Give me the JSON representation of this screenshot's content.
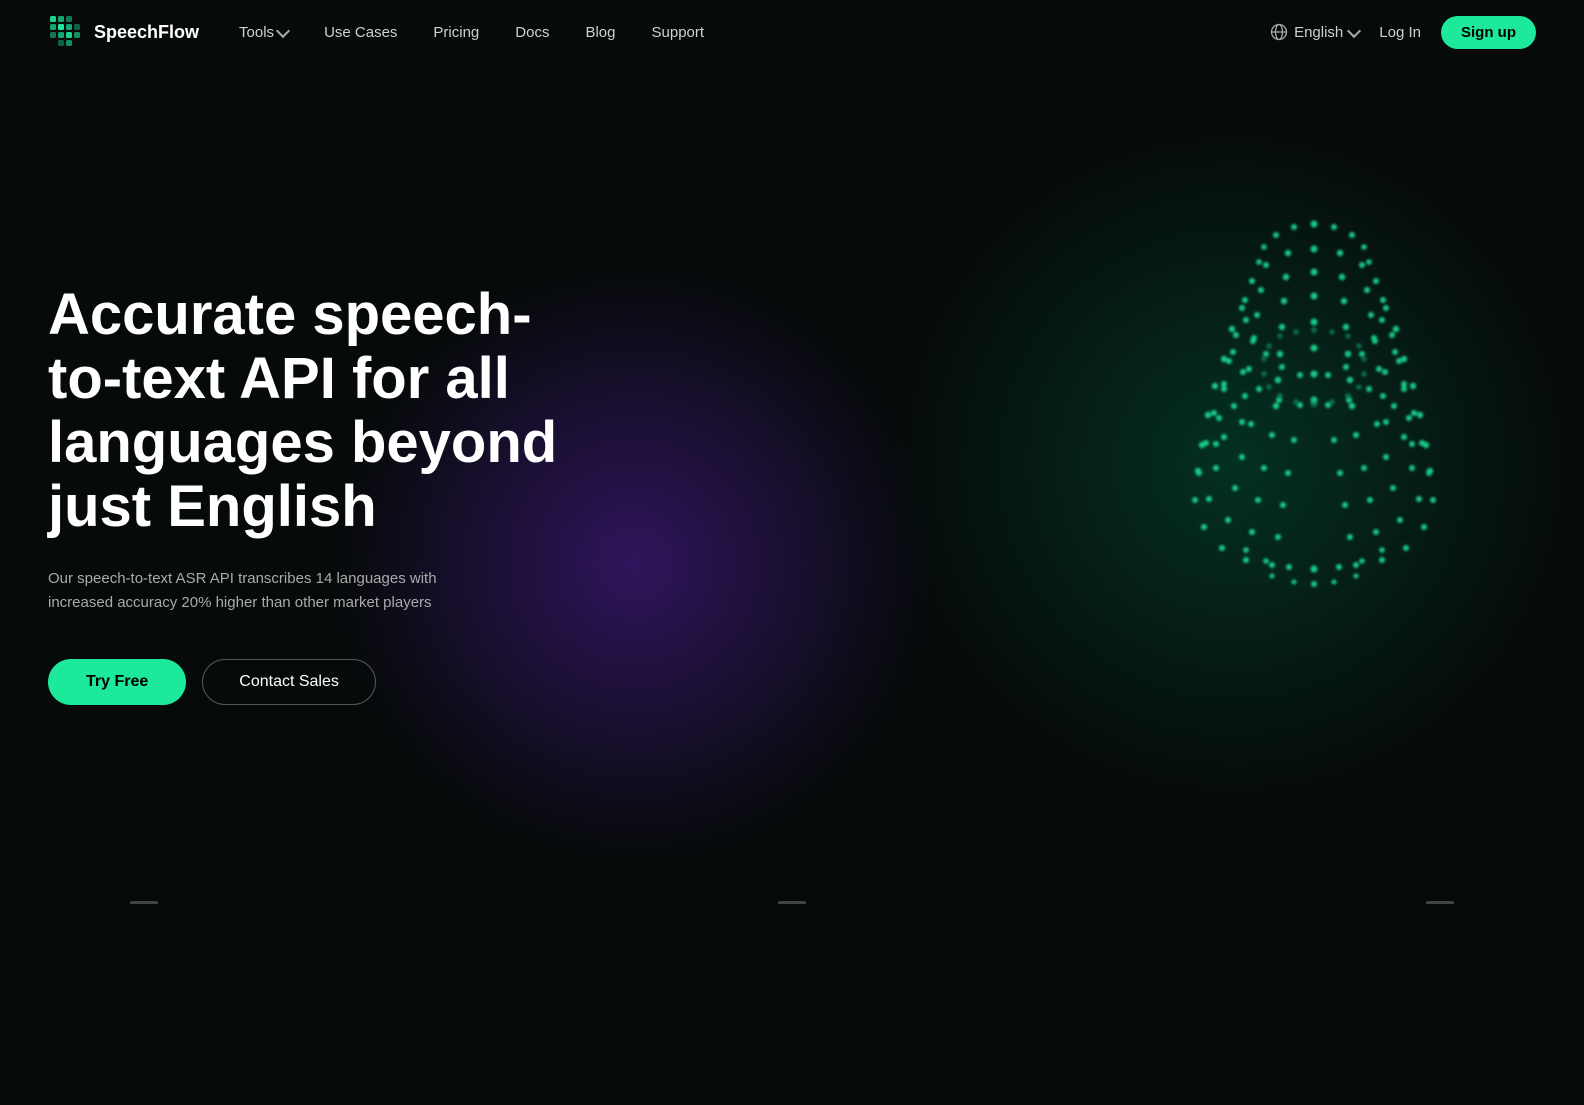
{
  "site": {
    "name": "SpeechFlow"
  },
  "nav": {
    "logo_text": "SpeechFlow",
    "links": [
      {
        "id": "tools",
        "label": "Tools",
        "hasDropdown": true
      },
      {
        "id": "use-cases",
        "label": "Use Cases",
        "hasDropdown": false
      },
      {
        "id": "pricing",
        "label": "Pricing",
        "hasDropdown": false
      },
      {
        "id": "docs",
        "label": "Docs",
        "hasDropdown": false
      },
      {
        "id": "blog",
        "label": "Blog",
        "hasDropdown": false
      },
      {
        "id": "support",
        "label": "Support",
        "hasDropdown": false
      }
    ],
    "language": "English",
    "login_label": "Log In",
    "signup_label": "Sign up"
  },
  "hero": {
    "headline": "Accurate speech-to-text API for all languages beyond just English",
    "subtext": "Our speech-to-text ASR API transcribes 14 languages with increased accuracy 20% higher than other market players",
    "btn_try_free": "Try Free",
    "btn_contact_sales": "Contact Sales"
  }
}
